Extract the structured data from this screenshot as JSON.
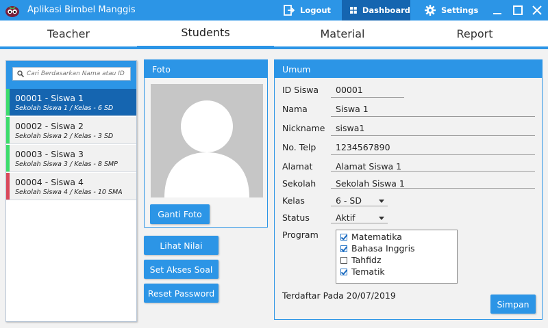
{
  "app": {
    "title": "Aplikasi Bimbel Manggis"
  },
  "titlebar": {
    "logout_label": "Logout",
    "dashboard_label": "Dashboard",
    "settings_label": "Settings"
  },
  "tabs": [
    {
      "label": "Teacher"
    },
    {
      "label": "Students"
    },
    {
      "label": "Material"
    },
    {
      "label": "Report"
    }
  ],
  "search": {
    "placeholder": "Cari Berdasarkan Nama atau ID"
  },
  "students": [
    {
      "name": "00001 - Siswa 1",
      "sub": "Sekolah Siswa 1 / Kelas - 6 SD",
      "status_color": "#3ddc6b"
    },
    {
      "name": "00002 - Siswa 2",
      "sub": "Sekolah Siswa 2 / Kelas - 3 SD",
      "status_color": "#3ddc6b"
    },
    {
      "name": "00003 - Siswa 3",
      "sub": "Sekolah Siswa 3 / Kelas - 8 SMP",
      "status_color": "#3ddc6b"
    },
    {
      "name": "00004 - Siswa 4",
      "sub": "Sekolah Siswa 4 / Kelas - 10 SMA",
      "status_color": "#d9485a"
    }
  ],
  "foto": {
    "title": "Foto",
    "change_label": "Ganti Foto"
  },
  "actions": {
    "lihat_nilai": "Lihat Nilai",
    "set_akses": "Set Akses Soal",
    "reset_password": "Reset Password"
  },
  "umum": {
    "title": "Umum",
    "id_label": "ID Siswa",
    "id_value": "00001",
    "nama_label": "Nama",
    "nama_value": "Siswa 1",
    "nickname_label": "Nickname",
    "nickname_value": "siswa1",
    "telp_label": "No. Telp",
    "telp_value": "1234567890",
    "alamat_label": "Alamat",
    "alamat_value": "Alamat Siswa 1",
    "sekolah_label": "Sekolah",
    "sekolah_value": "Sekolah Siswa 1",
    "kelas_label": "Kelas",
    "kelas_value": "6 - SD",
    "status_label": "Status",
    "status_value": "Aktif",
    "program_label": "Program",
    "programs": [
      {
        "label": "Matematika",
        "checked": true
      },
      {
        "label": "Bahasa Inggris",
        "checked": true
      },
      {
        "label": "Tahfidz",
        "checked": false
      },
      {
        "label": "Tematik",
        "checked": true
      }
    ],
    "terdaftar": "Terdaftar Pada 20/07/2019",
    "simpan_label": "Simpan"
  },
  "colors": {
    "accent": "#2c95e6",
    "accent_dark": "#1565b0"
  }
}
